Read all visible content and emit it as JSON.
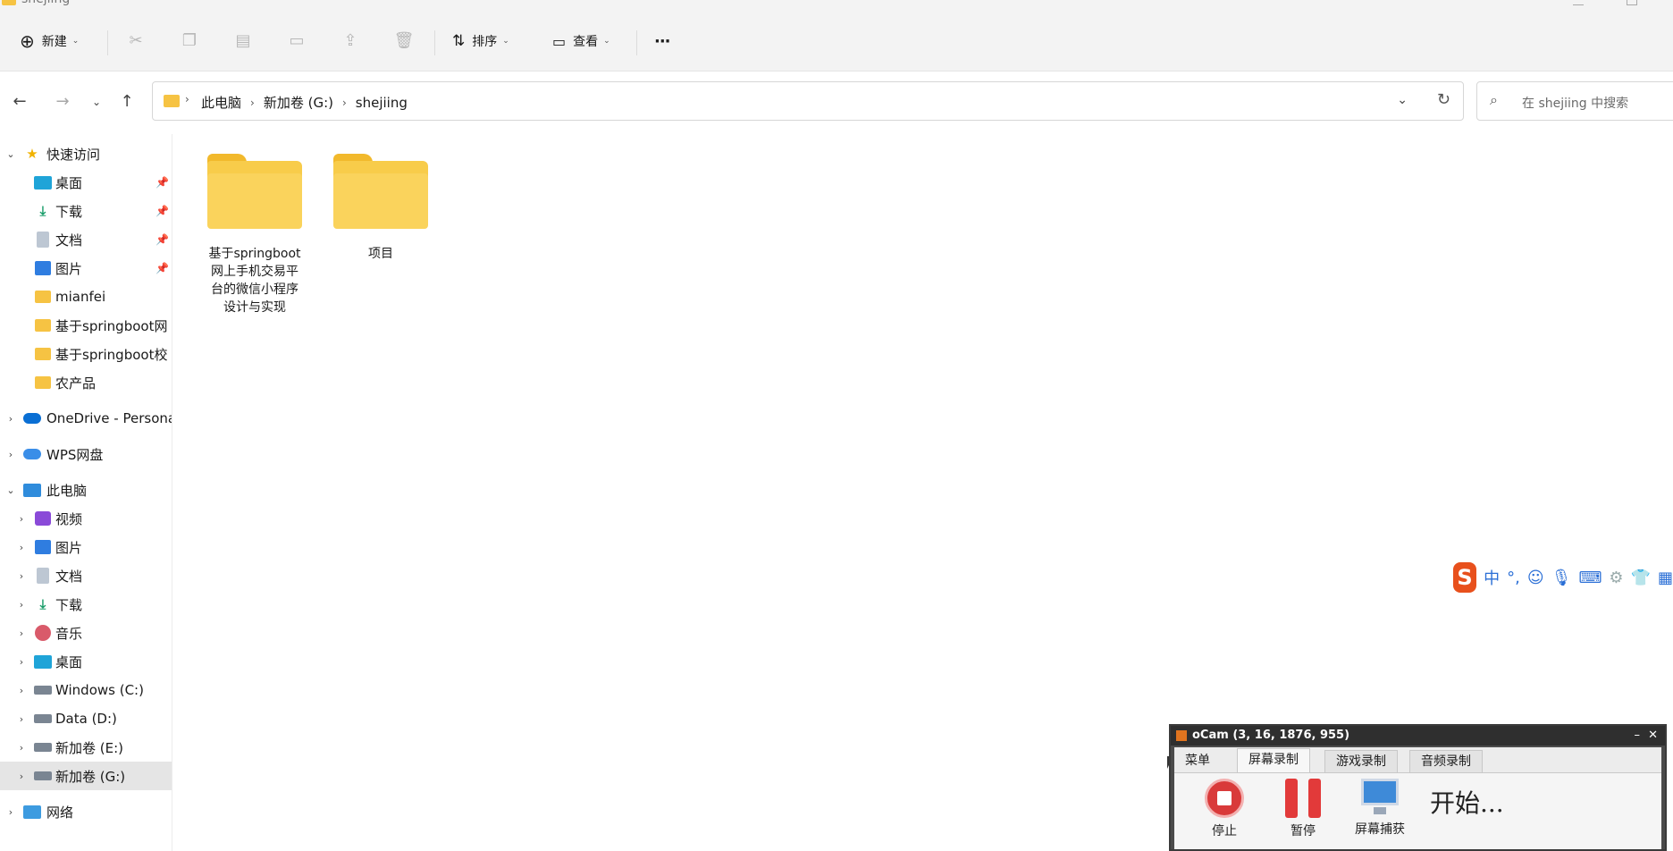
{
  "window": {
    "title": "shejiing"
  },
  "toolbar": {
    "new_label": "新建",
    "sort_label": "排序",
    "view_label": "查看",
    "more_label": "···"
  },
  "breadcrumb": {
    "items": [
      "此电脑",
      "新加卷 (G:)",
      "shejiing"
    ]
  },
  "search": {
    "placeholder": "在 shejiing 中搜索"
  },
  "sidebar": {
    "quick_access": {
      "label": "快速访问",
      "items": [
        {
          "label": "桌面",
          "icon": "desktop-icon",
          "pinned": true
        },
        {
          "label": "下载",
          "icon": "download-icon",
          "pinned": true
        },
        {
          "label": "文档",
          "icon": "document-icon",
          "pinned": true
        },
        {
          "label": "图片",
          "icon": "picture-icon",
          "pinned": true
        },
        {
          "label": "mianfei",
          "icon": "folder-icon",
          "pinned": false
        },
        {
          "label": "基于springboot网",
          "icon": "folder-icon",
          "pinned": false
        },
        {
          "label": "基于springboot校",
          "icon": "folder-icon",
          "pinned": false
        },
        {
          "label": "农产品",
          "icon": "folder-icon",
          "pinned": false
        }
      ]
    },
    "onedrive": {
      "label": "OneDrive - Persona"
    },
    "wps": {
      "label": "WPS网盘"
    },
    "this_pc": {
      "label": "此电脑",
      "items": [
        {
          "label": "视频",
          "icon": "video-icon"
        },
        {
          "label": "图片",
          "icon": "picture-icon"
        },
        {
          "label": "文档",
          "icon": "document-icon"
        },
        {
          "label": "下载",
          "icon": "download-icon"
        },
        {
          "label": "音乐",
          "icon": "music-icon"
        },
        {
          "label": "桌面",
          "icon": "desktop-icon"
        },
        {
          "label": "Windows (C:)",
          "icon": "drive-icon"
        },
        {
          "label": "Data (D:)",
          "icon": "drive-icon"
        },
        {
          "label": "新加卷 (E:)",
          "icon": "drive-icon"
        },
        {
          "label": "新加卷 (G:)",
          "icon": "drive-icon",
          "selected": true
        }
      ]
    },
    "network": {
      "label": "网络"
    }
  },
  "content": {
    "folders": [
      {
        "name_lines": [
          "基于springboot",
          "网上手机交易平",
          "台的微信小程序",
          "设计与实现"
        ]
      },
      {
        "name_lines": [
          "项目"
        ]
      }
    ]
  },
  "ime": {
    "logo": "S",
    "mode": "中",
    "punct": "°,"
  },
  "ocam": {
    "title": "oCam (3, 16, 1876, 955)",
    "tabs": [
      "菜单",
      "屏幕录制",
      "游戏录制",
      "音频录制"
    ],
    "active_tab": "屏幕录制",
    "buttons": [
      {
        "label": "停止",
        "icon": "stop-record-icon"
      },
      {
        "label": "暂停",
        "icon": "pause-icon"
      },
      {
        "label": "屏幕捕获",
        "icon": "screen-capture-icon"
      }
    ],
    "status": "开始..."
  }
}
